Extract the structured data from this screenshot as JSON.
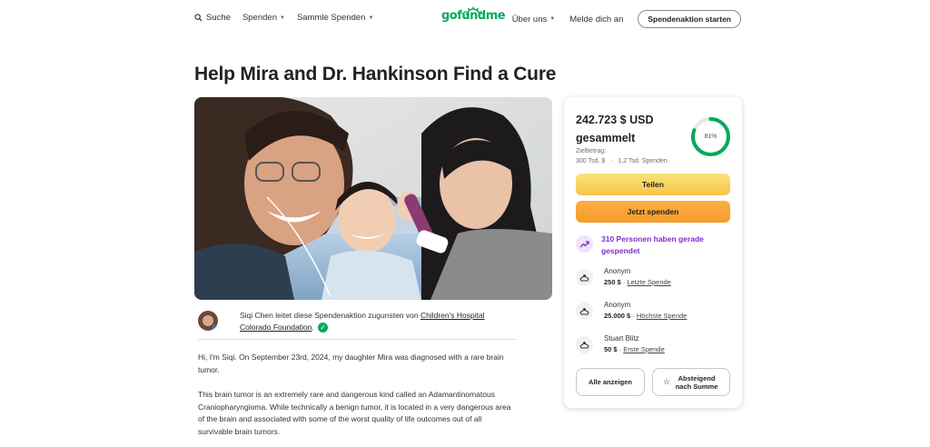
{
  "header": {
    "search_label": "Suche",
    "donate_menu": "Spenden",
    "fundraise_menu": "Sammle Spenden",
    "logo_text": "gofundme",
    "about_menu": "Über uns",
    "sign_in": "Melde dich an",
    "start_button": "Spendenaktion starten"
  },
  "page": {
    "title": "Help Mira and Dr. Hankinson Find a Cure"
  },
  "organizer": {
    "text_prefix": "Siqi Chen leitet diese Spendenaktion zugunsten von",
    "beneficiary_link": "Children's Hospital Colorado Foundation"
  },
  "story": {
    "paragraphs": [
      "Hi, I'm Siqi. On September 23rd, 2024, my daughter Mira was diagnosed with a rare brain tumor.",
      "This brain tumor is an extremely rare and dangerous kind called an Adamantinomatous Craniopharyngioma. While technically a benign tumor, it is located in a very dangerous area of the brain and associated with some of the worst quality of life outcomes out of all survivable brain tumors."
    ]
  },
  "card": {
    "amount_raised": "242.723 $ USD gesammelt",
    "goal_label": "Zielbetrag:",
    "goal_value": "300 Tsd. $",
    "donations_count": "1,2 Tsd. Spenden",
    "separator": "·",
    "progress_label": "81%",
    "progress_fraction": 0.81,
    "share_button": "Teilen",
    "donate_button": "Jetzt spenden",
    "trending_text": "310 Personen haben gerade gespendet",
    "donors": [
      {
        "name": "Anonym",
        "amount": "250 $",
        "separator": "·",
        "tag": "Letzte Spende"
      },
      {
        "name": "Anonym",
        "amount": "25.000 $",
        "separator": "·",
        "tag": "Höchste Spende"
      },
      {
        "name": "Stuart Blitz",
        "amount": "50 $",
        "separator": "·",
        "tag": "Erste Spende"
      }
    ],
    "see_all_button": "Alle anzeigen",
    "see_top_button": "Absteigend nach Summe"
  },
  "colors": {
    "brand_green": "#02a95c",
    "share_yellow": "#f8d25d",
    "donate_orange": "#f8a535",
    "trend_purple": "#7b2fcc"
  },
  "icons": [
    "search-icon",
    "chevron-down-icon",
    "verified-check-icon",
    "trending-up-icon",
    "donor-hand-icon",
    "star-icon"
  ]
}
